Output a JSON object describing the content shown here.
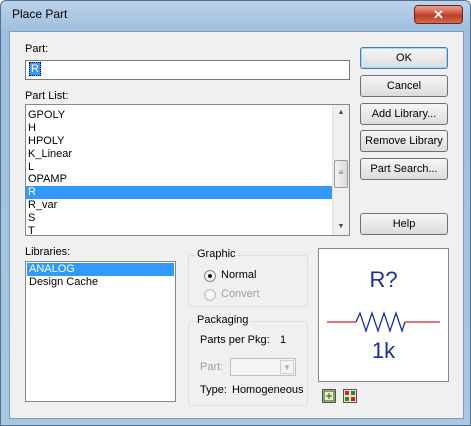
{
  "window": {
    "title": "Place Part",
    "close_glyph": "✕"
  },
  "part": {
    "label": "Part:",
    "value": "R"
  },
  "part_list": {
    "label": "Part List:",
    "items": [
      "GPOLY",
      "H",
      "HPOLY",
      "K_Linear",
      "L",
      "OPAMP",
      "R",
      "R_var",
      "S",
      "T"
    ],
    "selected": "R"
  },
  "buttons": {
    "ok": "OK",
    "cancel": "Cancel",
    "add_library": "Add Library...",
    "remove_library": "Remove Library",
    "part_search": "Part Search...",
    "help": "Help"
  },
  "libraries": {
    "label": "Libraries:",
    "items": [
      "ANALOG",
      "Design Cache"
    ],
    "selected": "ANALOG"
  },
  "graphic": {
    "label": "Graphic",
    "normal": "Normal",
    "convert": "Convert",
    "selected": "Normal"
  },
  "packaging": {
    "label": "Packaging",
    "parts_per_pkg_label": "Parts per Pkg:",
    "parts_per_pkg_value": "1",
    "part_label": "Part:",
    "type_label": "Type:",
    "type_value": "Homogeneous"
  },
  "preview": {
    "reference": "R?",
    "value": "1k",
    "wire_color": "#c0272d",
    "symbol_color": "#1e2f8e"
  },
  "icons": [
    "view-symbol-icon",
    "view-package-icon"
  ]
}
